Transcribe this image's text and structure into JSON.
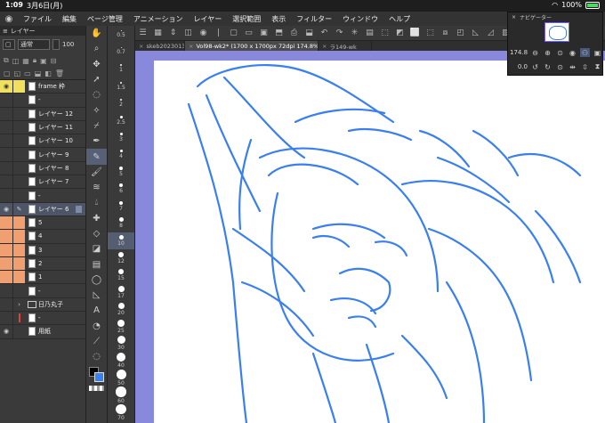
{
  "status": {
    "time": "1:09",
    "date": "3月6日(月)",
    "battery": "100%"
  },
  "menu": [
    "ファイル",
    "編集",
    "ページ管理",
    "アニメーション",
    "レイヤー",
    "選択範囲",
    "表示",
    "フィルター",
    "ウィンドウ",
    "ヘルプ"
  ],
  "layer_panel": {
    "tab": "レイヤー",
    "blend_mode": "通常",
    "opacity": "100",
    "layers": [
      {
        "name": "frame 枠",
        "color": "yellow",
        "type": "layer"
      },
      {
        "name": "-",
        "color": "",
        "type": "layer"
      },
      {
        "name": "レイヤー 12",
        "color": "",
        "type": "layer"
      },
      {
        "name": "レイヤー 11",
        "color": "",
        "type": "layer"
      },
      {
        "name": "レイヤー 10",
        "color": "",
        "type": "layer"
      },
      {
        "name": "レイヤー 9",
        "color": "",
        "type": "layer"
      },
      {
        "name": "レイヤー 8",
        "color": "",
        "type": "layer"
      },
      {
        "name": "レイヤー 7",
        "color": "",
        "type": "layer"
      },
      {
        "name": "-",
        "color": "",
        "type": "layer"
      },
      {
        "name": "レイヤー 6",
        "color": "",
        "type": "layer",
        "selected": true
      },
      {
        "name": "5",
        "color": "orange",
        "type": "layer"
      },
      {
        "name": "4",
        "color": "orange",
        "type": "layer"
      },
      {
        "name": "3",
        "color": "orange",
        "type": "layer"
      },
      {
        "name": "2",
        "color": "orange",
        "type": "layer"
      },
      {
        "name": "1",
        "color": "orange",
        "type": "layer"
      },
      {
        "name": "-",
        "color": "",
        "type": "layer"
      },
      {
        "name": "日乃丸子",
        "color": "",
        "type": "folder"
      },
      {
        "name": "-",
        "color": "",
        "type": "layer"
      },
      {
        "name": "用紙",
        "color": "",
        "type": "paper"
      }
    ]
  },
  "brush_sizes": [
    "0.5",
    "0.7",
    "1",
    "1.5",
    "2",
    "2.5",
    "3",
    "4",
    "5",
    "6",
    "7",
    "8",
    "10",
    "12",
    "15",
    "17",
    "20",
    "25",
    "30",
    "40",
    "50",
    "60",
    "70",
    "80",
    "100",
    "120",
    "150",
    "170",
    "200"
  ],
  "active_size": "10",
  "tabs": [
    {
      "label": "skeb2023013(",
      "active": false
    },
    {
      "label": "Vol98-wk2* (1700 x 1700px 72dpi 174.8%)",
      "active": true
    },
    {
      "label": "ラ149-wk",
      "active": false
    }
  ],
  "navigator": {
    "title": "ナビゲーター",
    "zoom": "174.8",
    "rotation": "0.0"
  },
  "colors": {
    "stroke": "#3a7ff0",
    "canvas_bg": "#8888dd",
    "selected_layer": "#4d5566"
  }
}
